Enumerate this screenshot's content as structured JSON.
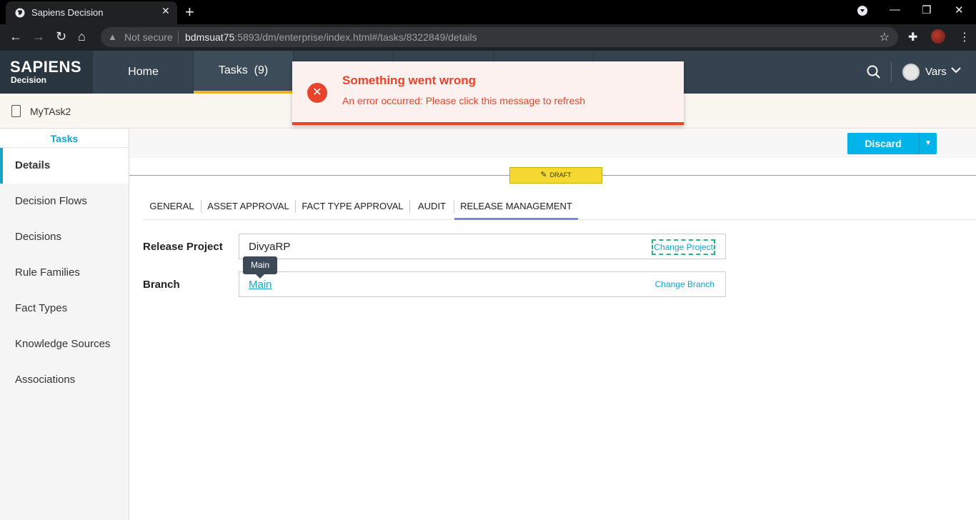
{
  "browser": {
    "tab_title": "Sapiens Decision",
    "security_label": "Not secure",
    "url_host": "bdmsuat75",
    "url_rest": ":5893/dm/enterprise/index.html#/tasks/8322849/details"
  },
  "app": {
    "brand_name": "SAPIENS",
    "brand_sub": "Decision",
    "nav": [
      {
        "label": "Home"
      },
      {
        "label": "Tasks  (9)"
      }
    ],
    "user_name": "Vars"
  },
  "task": {
    "name": "MyTAsk2"
  },
  "sidebar": {
    "header": "Tasks",
    "items": [
      {
        "label": "Details"
      },
      {
        "label": "Decision Flows"
      },
      {
        "label": "Decisions"
      },
      {
        "label": "Rule Families"
      },
      {
        "label": "Fact Types"
      },
      {
        "label": "Knowledge Sources"
      },
      {
        "label": "Associations"
      }
    ]
  },
  "actions": {
    "discard_label": "Discard"
  },
  "status_badge": "DRAFT",
  "subtabs": [
    {
      "label": "GENERAL"
    },
    {
      "label": "ASSET APPROVAL"
    },
    {
      "label": "FACT TYPE APPROVAL"
    },
    {
      "label": "AUDIT"
    },
    {
      "label": "RELEASE MANAGEMENT"
    }
  ],
  "release": {
    "project_label": "Release Project",
    "project_value": "DivyaRP",
    "change_project": "Change Project",
    "branch_label": "Branch",
    "branch_value": "Main",
    "change_branch": "Change Branch",
    "tooltip": "Main"
  },
  "toast": {
    "title": "Something went wrong",
    "message": "An error occurred: Please click this message to refresh",
    "color": "#e8432b"
  },
  "colors": {
    "accent": "#1aa3c8",
    "header_bg": "#34434f",
    "active_tab_underline": "#f0b323",
    "discard_bg": "#00b3e8",
    "draft_bg": "#f5d832"
  }
}
